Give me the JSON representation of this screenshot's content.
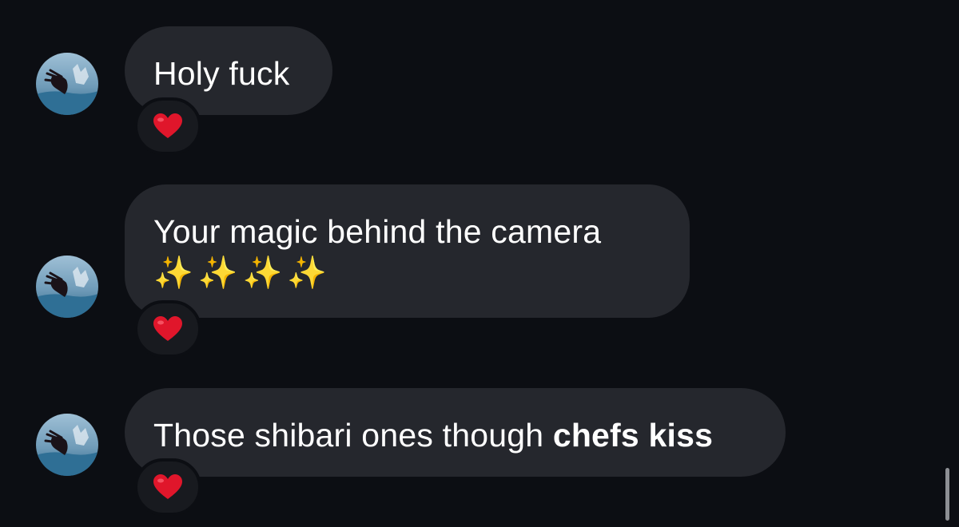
{
  "messages": [
    {
      "text": "Holy fuck",
      "reaction": "❤️"
    },
    {
      "text": "Your magic behind the camera",
      "emoji_line": "✨✨✨✨",
      "reaction": "❤️"
    },
    {
      "text": "Those shibari ones though ",
      "bold_text": "chefs kiss",
      "reaction": "❤️"
    }
  ],
  "colors": {
    "background": "#0c0e13",
    "bubble": "#25272d",
    "reaction_pill": "#181a1f",
    "heart": "#e0162b",
    "sparkle": "#ffd53a"
  },
  "icons": {
    "avatar": "profile-photo",
    "reaction": "red-heart-icon"
  }
}
